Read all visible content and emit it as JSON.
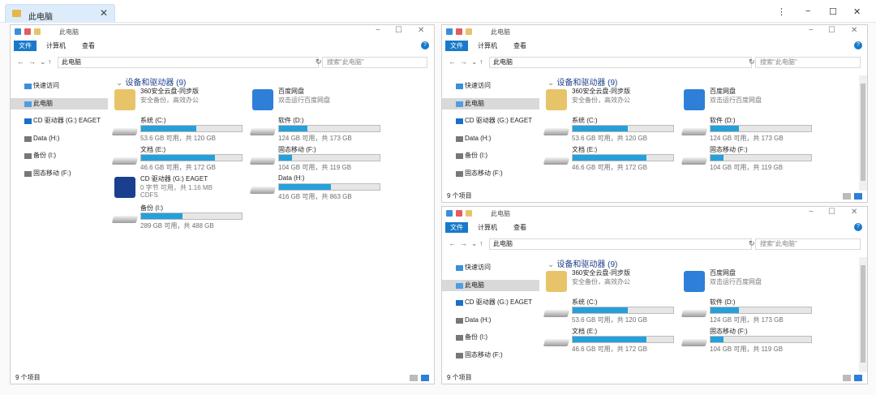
{
  "tab": {
    "title": "此电脑",
    "close": "✕"
  },
  "window_controls": {
    "more": "⋮",
    "min": "−",
    "max": "☐",
    "close": "✕"
  },
  "explorer": {
    "title": "此电脑",
    "ribbon_tabs": [
      "文件",
      "计算机",
      "查看"
    ],
    "path": "此电脑",
    "search_placeholder": "搜索\"此电脑\"",
    "sidebar": [
      "快速访问",
      "此电脑",
      "CD 驱动器 (G:) EAGET",
      "Data (H:)",
      "备份 (I:)",
      "固态移动 (F:)"
    ],
    "group_header": "设备和驱动器 (9)",
    "status": "9 个项目",
    "items": [
      {
        "name": "360安全云盘-同步版",
        "sub": "安全备份，高效办公"
      },
      {
        "name": "百度网盘",
        "sub": "双击运行百度网盘"
      },
      {
        "name": "系统 (C:)",
        "cap": "53.6 GB 可用，共 120 GB",
        "used": 0.55
      },
      {
        "name": "软件 (D:)",
        "cap": "124 GB 可用，共 173 GB",
        "used": 0.28
      },
      {
        "name": "文档 (E:)",
        "cap": "46.6 GB 可用，共 172 GB",
        "used": 0.73
      },
      {
        "name": "固态移动 (F:)",
        "cap": "104 GB 可用，共 119 GB",
        "used": 0.13
      },
      {
        "name": "CD 驱动器 (G:) EAGET",
        "sub": "0 字节 可用，共 1.16 MB",
        "sub2": "CDFS"
      },
      {
        "name": "Data (H:)",
        "cap": "416 GB 可用，共 863 GB",
        "used": 0.52
      },
      {
        "name": "备份 (I:)",
        "cap": "289 GB 可用，共 488 GB",
        "used": 0.41
      },
      {
        "name": "CD 驱动器 (G:) EAGET"
      },
      {
        "name": "Data (H:)"
      }
    ]
  },
  "colors": {
    "accent": "#1979ca",
    "bar": "#26a0da",
    "header": "#1e3f8c"
  }
}
